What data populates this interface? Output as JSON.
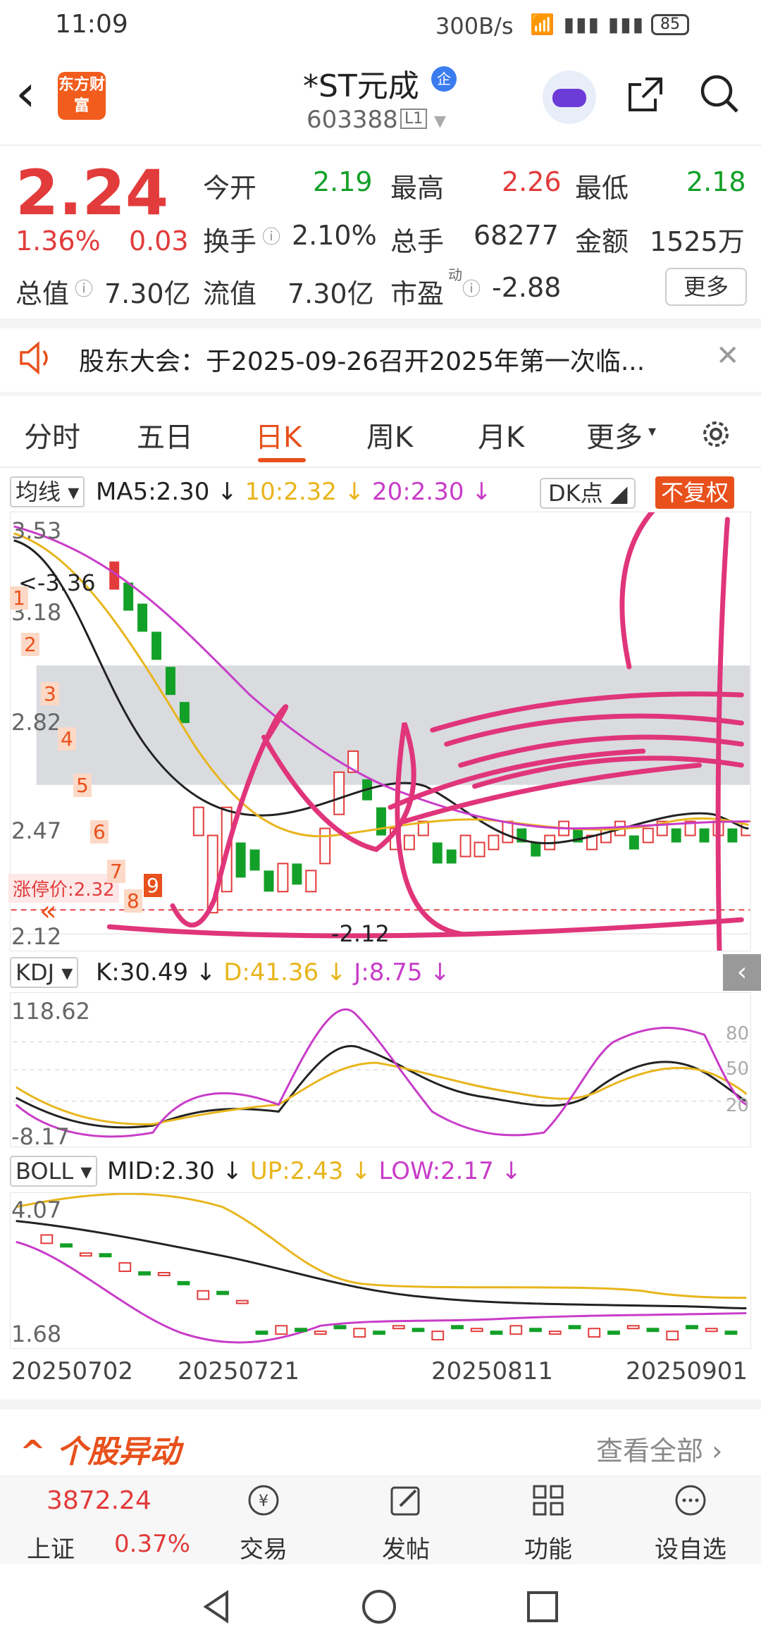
{
  "status": {
    "time": "11:09",
    "net": "300B/s",
    "signal": "4G 4G",
    "battery": "85"
  },
  "header": {
    "brand": "东方财富",
    "title": "*ST元成",
    "tag": "企",
    "code": "603388",
    "level": "L1"
  },
  "quote": {
    "price": "2.24",
    "change_pct": "1.36%",
    "change": "0.03",
    "open_label": "今开",
    "open": "2.19",
    "high_label": "最高",
    "high": "2.26",
    "low_label": "最低",
    "low": "2.18",
    "turnover_label": "换手",
    "turnover": "2.10%",
    "volume_label": "总手",
    "volume": "68277",
    "amount_label": "金额",
    "amount": "1525万",
    "mktcap_label": "总值",
    "mktcap": "7.30亿",
    "float_label": "流值",
    "float": "7.30亿",
    "pe_label": "市盈",
    "pe_sup": "动",
    "pe": "-2.88",
    "more": "更多"
  },
  "notice": {
    "text": "股东大会：于2025-09-26召开2025年第一次临..."
  },
  "tabs": {
    "items": [
      "分时",
      "五日",
      "日K",
      "周K",
      "月K",
      "更多"
    ],
    "active": "日K"
  },
  "ma": {
    "selector": "均线",
    "ma5": "MA5:2.30",
    "ma10": "10:2.32",
    "ma20": "20:2.30",
    "dk": "DK点",
    "fq": "不复权"
  },
  "kline": {
    "y_labels": [
      "3.53",
      "3.18",
      "2.82",
      "2.47",
      "2.12"
    ],
    "max_marker": "<-3.36",
    "min_marker": "-2.12",
    "limit_price": "涨停价:2.32",
    "countdown": [
      "1",
      "2",
      "3",
      "4",
      "5",
      "6",
      "7",
      "8",
      "9"
    ]
  },
  "kdj": {
    "selector": "KDJ",
    "k": "K:30.49",
    "d": "D:41.36",
    "j": "J:8.75",
    "y_top": "118.62",
    "y_bottom": "-8.17",
    "ref_80": "80",
    "ref_50": "50",
    "ref_20": "20"
  },
  "boll": {
    "selector": "BOLL",
    "mid": "MID:2.30",
    "up": "UP:2.43",
    "low": "LOW:2.17",
    "y_top": "4.07",
    "y_bottom": "1.68"
  },
  "dates": [
    "20250702",
    "20250721",
    "20250811",
    "20250901"
  ],
  "movers": {
    "title": "个股异动",
    "view_all": "查看全部"
  },
  "bottom_bar": {
    "index_value": "3872.24",
    "index_name": "上证",
    "index_pct": "0.37%",
    "trade": "交易",
    "post": "发帖",
    "functions": "功能",
    "watchlist": "设自选"
  },
  "colors": {
    "up": "#e23b3b",
    "down": "#13a028",
    "accent": "#e8501c",
    "ma10": "#e8b51c",
    "ma20": "#c83cc8",
    "annotation": "#e0357a"
  }
}
